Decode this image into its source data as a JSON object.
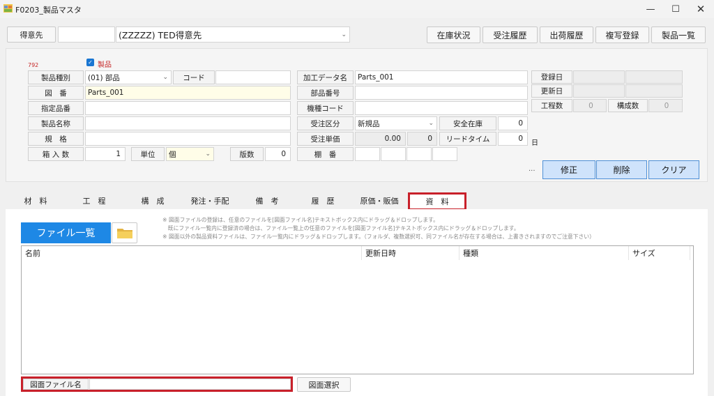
{
  "window": {
    "title": "F0203_製品マスタ"
  },
  "top": {
    "customer_label": "得意先",
    "customer_code": "",
    "customer_name": "(ZZZZZ) TED得意先",
    "buttons": [
      "在庫状況",
      "受注履歴",
      "出荷履歴",
      "複写登録",
      "製品一覧"
    ]
  },
  "form": {
    "record_no": "792",
    "product_checkbox_label": "製品",
    "product_checked": true,
    "labels": {
      "product_type": "製品種別",
      "code": "コード",
      "drawing_no": "図　番",
      "designated_no": "指定品番",
      "product_name": "製品名称",
      "spec": "規　格",
      "box_qty": "箱 入 数",
      "unit": "単位",
      "version": "版数",
      "processing_data_name": "加工データ名",
      "part_no": "部品番号",
      "model_code": "機種コード",
      "order_category": "受注区分",
      "safety_stock": "安全在庫",
      "order_price": "受注単価",
      "lead_time": "リードタイム",
      "shelf_no": "棚　番",
      "reg_date": "登録日",
      "upd_date": "更新日",
      "process_count": "工程数",
      "composition_count": "構成数",
      "day_unit": "日"
    },
    "values": {
      "product_type": "(01) 部品",
      "code": "",
      "drawing_no": "Parts_001",
      "designated_no": "",
      "product_name": "",
      "spec": "",
      "box_qty": "1",
      "unit": "個",
      "version": "0",
      "processing_data_name": "Parts_001",
      "part_no": "",
      "model_code": "",
      "order_category": "新規品",
      "safety_stock": "0",
      "order_price": "0.00",
      "order_price_sub": "0",
      "lead_time": "0",
      "process_count": "0",
      "composition_count": "0"
    },
    "ellipsis": "...",
    "action_buttons": [
      "修正",
      "削除",
      "クリア"
    ]
  },
  "tabs": [
    "材　料",
    "工　程",
    "構　成",
    "発注・手配",
    "備　考",
    "履　歴",
    "原価・販価",
    "資　料"
  ],
  "active_tab": "資　料",
  "documents": {
    "file_list_button": "ファイル一覧",
    "notes": [
      "※ 図面ファイルの登録は、任意のファイルを[図面ファイル名]テキストボックス内にドラッグ＆ドロップします。",
      "　既にファイル一覧内に登録済の場合は、ファイル一覧上の任意のファイルを[図面ファイル名]テキストボックス内にドラッグ＆ドロップします。",
      "※ 図面以外の製品資料ファイルは、ファイル一覧内にドラッグ＆ドロップします。（フォルダ、複数選択可、同ファイル名が存在する場合は、上書きされますのでご注意下さい）"
    ],
    "columns": [
      "名前",
      "更新日時",
      "種類",
      "サイズ"
    ],
    "drawing_file_label": "図面ファイル名",
    "drawing_file_value": "",
    "drawing_select_button": "図面選択"
  },
  "colors": {
    "accent": "#1e88e5",
    "highlight_red": "#c8202a"
  }
}
